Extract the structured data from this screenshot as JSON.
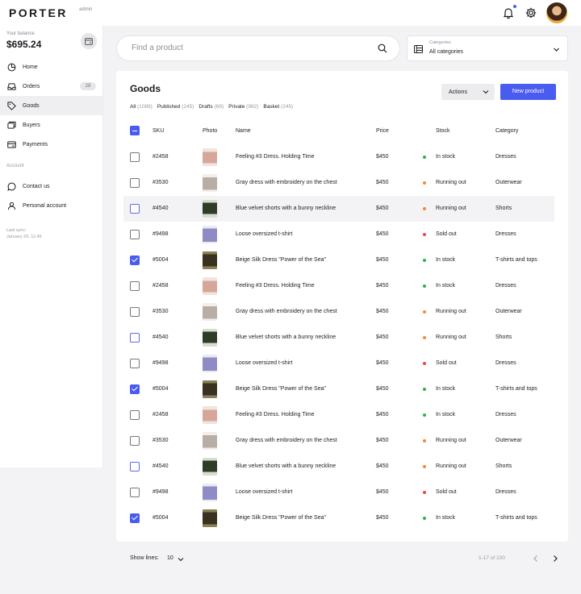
{
  "brand": {
    "name": "PORTER",
    "sub": "admin"
  },
  "colors": {
    "accent": "#4a5cf0",
    "in_stock": "#2fb344",
    "running_out": "#f08a3c",
    "sold_out": "#e5484d"
  },
  "sidebar": {
    "balance_label": "Your balance",
    "balance_value": "$695.24",
    "items": [
      {
        "label": "Home",
        "icon": "pie-chart-icon"
      },
      {
        "label": "Orders",
        "icon": "inbox-icon",
        "badge": "28"
      },
      {
        "label": "Goods",
        "icon": "tag-icon",
        "active": true
      },
      {
        "label": "Buyers",
        "icon": "people-card-icon"
      },
      {
        "label": "Payments",
        "icon": "card-icon"
      }
    ],
    "section_label": "Account",
    "account_items": [
      {
        "label": "Contact us",
        "icon": "chat-icon"
      },
      {
        "label": "Personal account",
        "icon": "user-icon"
      }
    ],
    "sync_label": "Last sync:",
    "sync_value": "January 29, 11:45"
  },
  "search": {
    "placeholder": "Find a product"
  },
  "categories": {
    "label": "Categories",
    "value": "All categories"
  },
  "goods": {
    "title": "Goods",
    "filters": [
      {
        "label": "All",
        "count": "(1089)"
      },
      {
        "label": "Published",
        "count": "(245)"
      },
      {
        "label": "Drafts",
        "count": "(69)"
      },
      {
        "label": "Private",
        "count": "(982)"
      },
      {
        "label": "Basket",
        "count": "(245)"
      }
    ],
    "actions_label": "Actions",
    "new_label": "New product",
    "columns": {
      "sku": "SKU",
      "photo": "Photo",
      "name": "Name",
      "price": "Price",
      "stock": "Stock",
      "category": "Category"
    },
    "rows": [
      {
        "sku": "#2458",
        "name": "Feeling #3 Dress. Holding Time",
        "price": "$450",
        "stock": "In stock",
        "category": "Dresses",
        "check": "empty",
        "photo": "pink"
      },
      {
        "sku": "#3530",
        "name": "Gray dress with embroidery on the chest",
        "price": "$450",
        "stock": "Running out",
        "category": "Outerwear",
        "check": "empty",
        "photo": "gray"
      },
      {
        "sku": "#4540",
        "name": "Blue velvet shorts with a bunny neckline",
        "price": "$450",
        "stock": "Running out",
        "category": "Shorts",
        "check": "blue",
        "photo": "green",
        "hover": true
      },
      {
        "sku": "#9498",
        "name": "Loose oversized t-shirt",
        "price": "$450",
        "stock": "Sold out",
        "category": "Dresses",
        "check": "empty",
        "photo": "purple"
      },
      {
        "sku": "#5004",
        "name": "Beige Silk Dress \"Power of the Sea\"",
        "price": "$450",
        "stock": "In stock",
        "category": "T-shirts and tops",
        "check": "checked",
        "photo": "olive"
      },
      {
        "sku": "#2458",
        "name": "Feeling #3 Dress. Holding Time",
        "price": "$450",
        "stock": "In stock",
        "category": "Dresses",
        "check": "empty",
        "photo": "pink"
      },
      {
        "sku": "#3530",
        "name": "Gray dress with embroidery on the chest",
        "price": "$450",
        "stock": "Running out",
        "category": "Outerwear",
        "check": "empty",
        "photo": "gray"
      },
      {
        "sku": "#4540",
        "name": "Blue velvet shorts with a bunny neckline",
        "price": "$450",
        "stock": "Running out",
        "category": "Shorts",
        "check": "blue",
        "photo": "green"
      },
      {
        "sku": "#9498",
        "name": "Loose oversized t-shirt",
        "price": "$450",
        "stock": "Sold out",
        "category": "Dresses",
        "check": "empty",
        "photo": "purple"
      },
      {
        "sku": "#5004",
        "name": "Beige Silk Dress \"Power of the Sea\"",
        "price": "$450",
        "stock": "In stock",
        "category": "T-shirts and tops",
        "check": "checked",
        "photo": "olive"
      },
      {
        "sku": "#2458",
        "name": "Feeling #3 Dress. Holding Time",
        "price": "$450",
        "stock": "In stock",
        "category": "Dresses",
        "check": "empty",
        "photo": "pink"
      },
      {
        "sku": "#3530",
        "name": "Gray dress with embroidery on the chest",
        "price": "$450",
        "stock": "Running out",
        "category": "Outerwear",
        "check": "empty",
        "photo": "gray"
      },
      {
        "sku": "#4540",
        "name": "Blue velvet shorts with a bunny neckline",
        "price": "$450",
        "stock": "Running out",
        "category": "Shorts",
        "check": "blue",
        "photo": "green"
      },
      {
        "sku": "#9498",
        "name": "Loose oversized t-shirt",
        "price": "$450",
        "stock": "Sold out",
        "category": "Dresses",
        "check": "empty",
        "photo": "purple"
      },
      {
        "sku": "#5004",
        "name": "Beige Silk Dress \"Power of the Sea\"",
        "price": "$450",
        "stock": "In stock",
        "category": "T-shirts and tops",
        "check": "checked",
        "photo": "olive"
      }
    ]
  },
  "footer": {
    "show_lines_label": "Show lines:",
    "show_lines_value": "10",
    "range": "1-17 of 100"
  }
}
